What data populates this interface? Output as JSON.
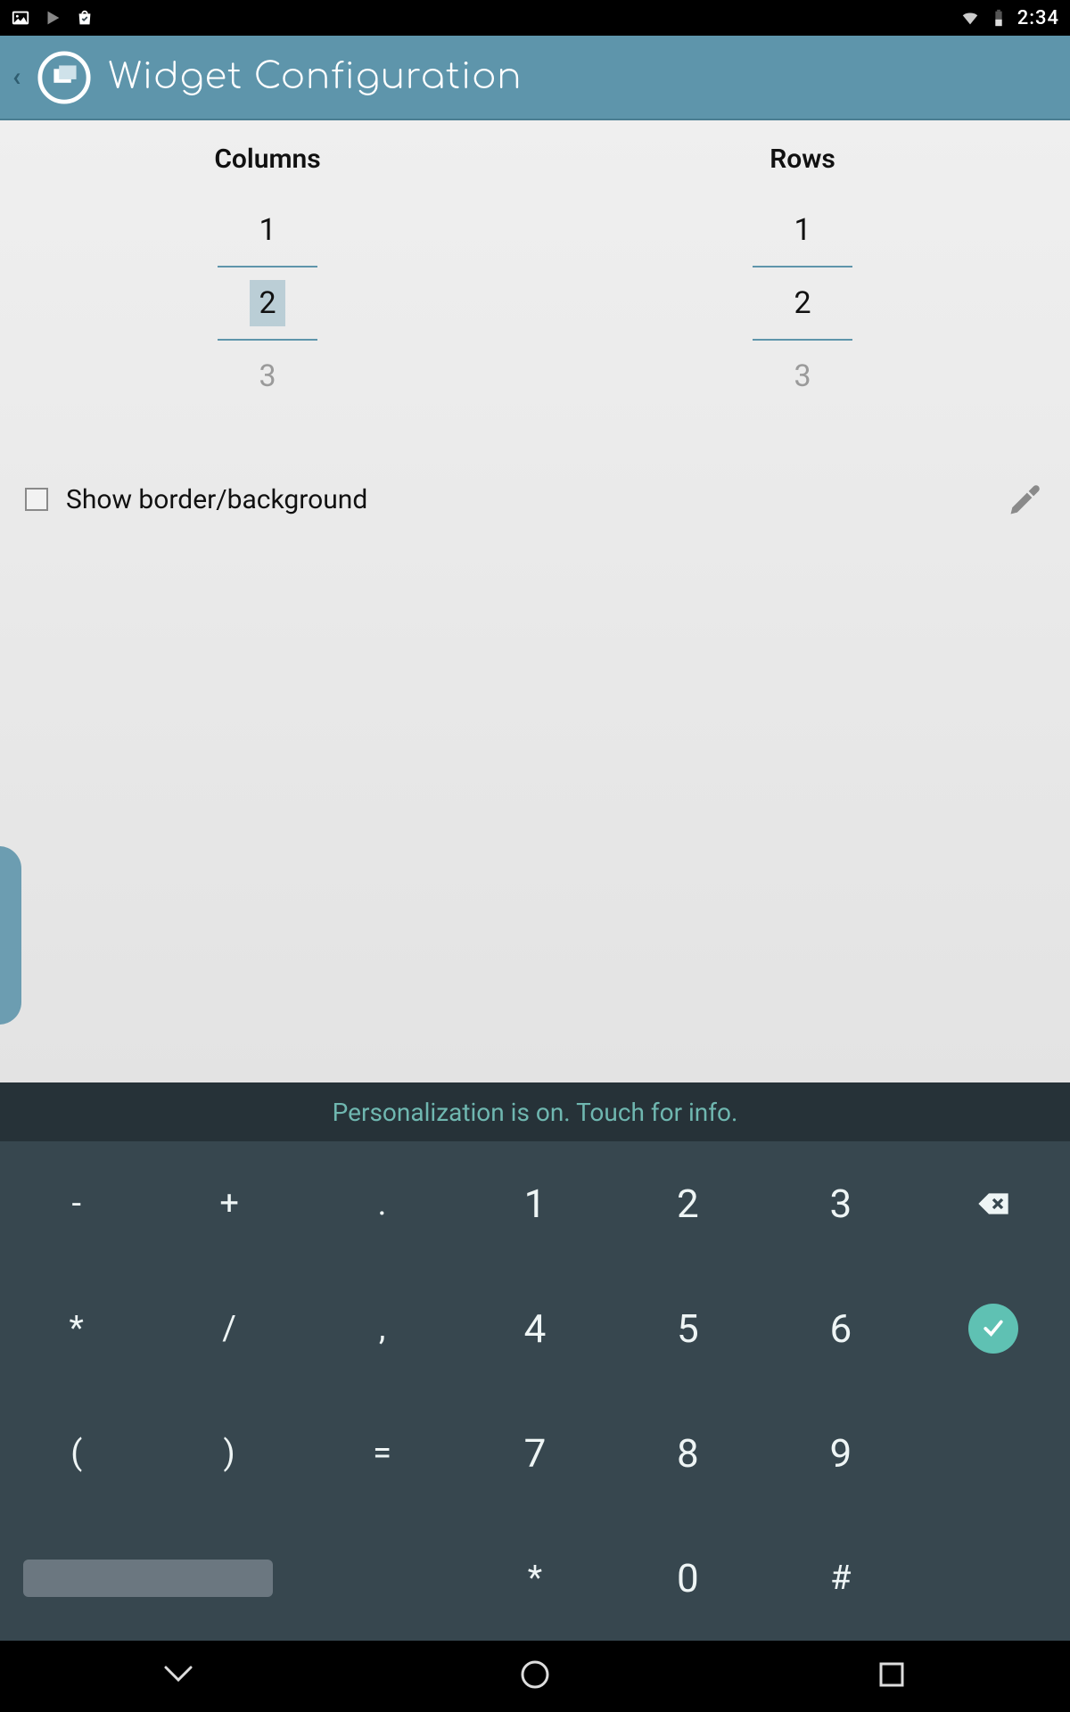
{
  "status": {
    "time": "2:34"
  },
  "appbar": {
    "title": "Widget Configuration"
  },
  "pickers": {
    "columns": {
      "label": "Columns",
      "prev": "1",
      "current": "2",
      "next": "3"
    },
    "rows": {
      "label": "Rows",
      "prev": "1",
      "current": "2",
      "next": "3"
    }
  },
  "options": {
    "show_border_label": "Show border/background",
    "show_border_checked": false
  },
  "keyboard": {
    "info": "Personalization is on. Touch for info.",
    "rows": [
      [
        "-",
        "+",
        ".",
        "1",
        "2",
        "3",
        "⌫"
      ],
      [
        "*",
        "/",
        ",",
        "4",
        "5",
        "6",
        "✓"
      ],
      [
        "(",
        ")",
        "=",
        "7",
        "8",
        "9",
        ""
      ],
      [
        "␠",
        "",
        "",
        "*",
        "0",
        "#",
        ""
      ]
    ]
  }
}
